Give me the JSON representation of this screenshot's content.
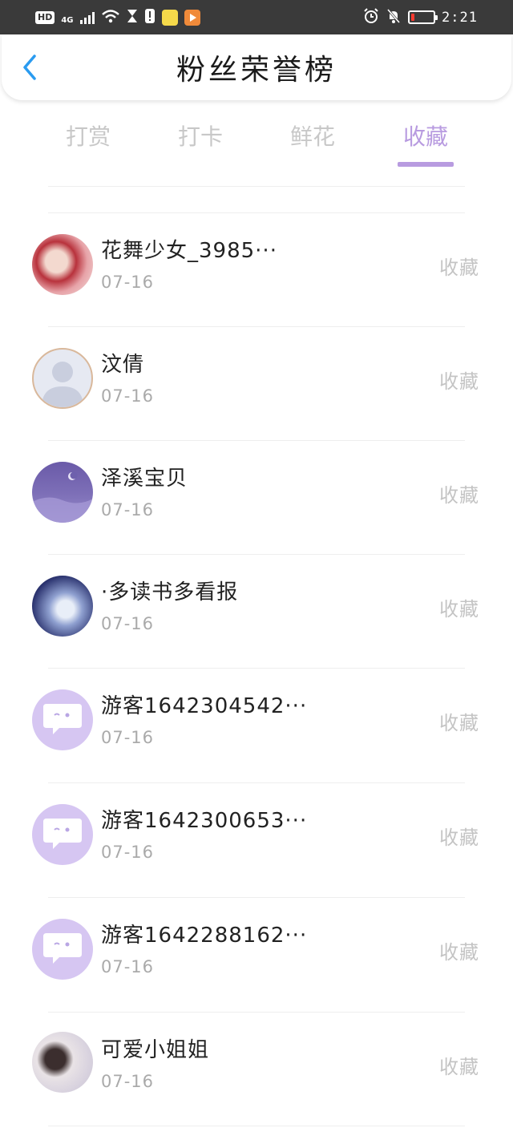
{
  "status_bar": {
    "badge": "HD",
    "network": "4G",
    "time": "2:21",
    "battery_percent": 15,
    "colors": {
      "bar": "#3a3a3a",
      "battery_low": "#ff3b30"
    }
  },
  "header": {
    "title": "粉丝荣誉榜",
    "back_icon": "chevron-left-icon",
    "back_color": "#2a9bf0"
  },
  "tabs": [
    {
      "label": "打赏",
      "active": false
    },
    {
      "label": "打卡",
      "active": false
    },
    {
      "label": "鲜花",
      "active": false
    },
    {
      "label": "收藏",
      "active": true
    }
  ],
  "accent_color": "#b89be0",
  "fans": [
    {
      "name": "花舞少女_3985···",
      "date": "07-16",
      "action": "收藏",
      "avatar": "photo-girl-red"
    },
    {
      "name": "汶倩",
      "date": "07-16",
      "action": "收藏",
      "avatar": "default-person"
    },
    {
      "name": "泽溪宝贝",
      "date": "07-16",
      "action": "收藏",
      "avatar": "night-moon"
    },
    {
      "name": "·多读书多看报",
      "date": "07-16",
      "action": "收藏",
      "avatar": "anime-moon"
    },
    {
      "name": "游客1642304542···",
      "date": "07-16",
      "action": "收藏",
      "avatar": "chat-bubble"
    },
    {
      "name": "游客1642300653···",
      "date": "07-16",
      "action": "收藏",
      "avatar": "chat-bubble"
    },
    {
      "name": "游客1642288162···",
      "date": "07-16",
      "action": "收藏",
      "avatar": "chat-bubble"
    },
    {
      "name": "可爱小姐姐",
      "date": "07-16",
      "action": "收藏",
      "avatar": "photo-girl-snow"
    }
  ]
}
